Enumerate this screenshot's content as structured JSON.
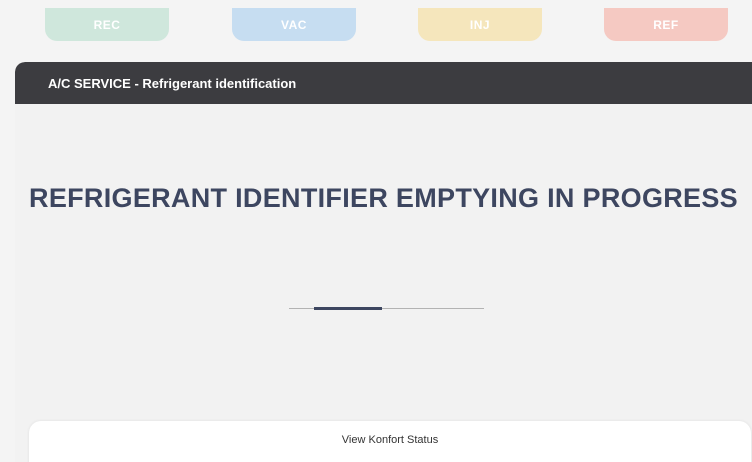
{
  "steps": [
    {
      "label": "REC",
      "color": "#cfe7dc"
    },
    {
      "label": "VAC",
      "color": "#c6ddf1"
    },
    {
      "label": "INJ",
      "color": "#f5e6bc"
    },
    {
      "label": "REF",
      "color": "#f5c9c2"
    }
  ],
  "panel": {
    "title": "A/C SERVICE - Refrigerant identification",
    "message": "REFRIGERANT IDENTIFIER EMPTYING IN PROGRESS",
    "progress": 0.35
  },
  "footer": {
    "button_label": "View Konfort Status"
  },
  "colors": {
    "header_bg": "#3c3c40",
    "accent": "#3d4660"
  }
}
